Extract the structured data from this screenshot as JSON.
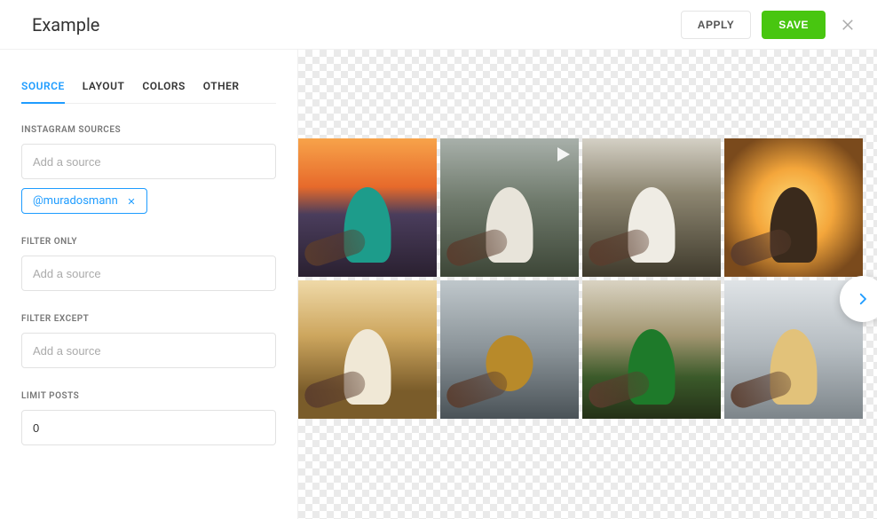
{
  "header": {
    "title": "Example",
    "apply_label": "APPLY",
    "save_label": "SAVE"
  },
  "tabs": [
    {
      "label": "SOURCE",
      "active": true
    },
    {
      "label": "LAYOUT",
      "active": false
    },
    {
      "label": "COLORS",
      "active": false
    },
    {
      "label": "OTHER",
      "active": false
    }
  ],
  "sections": {
    "instagram_sources": {
      "label": "INSTAGRAM SOURCES",
      "placeholder": "Add a source",
      "chips": [
        "@muradosmann"
      ]
    },
    "filter_only": {
      "label": "FILTER ONLY",
      "placeholder": "Add a source"
    },
    "filter_except": {
      "label": "FILTER EXCEPT",
      "placeholder": "Add a source"
    },
    "limit_posts": {
      "label": "LIMIT POSTS",
      "value": "0"
    }
  },
  "preview": {
    "items": [
      {
        "kind": "image"
      },
      {
        "kind": "video"
      },
      {
        "kind": "image"
      },
      {
        "kind": "image"
      },
      {
        "kind": "image"
      },
      {
        "kind": "image"
      },
      {
        "kind": "image"
      },
      {
        "kind": "video"
      }
    ]
  }
}
